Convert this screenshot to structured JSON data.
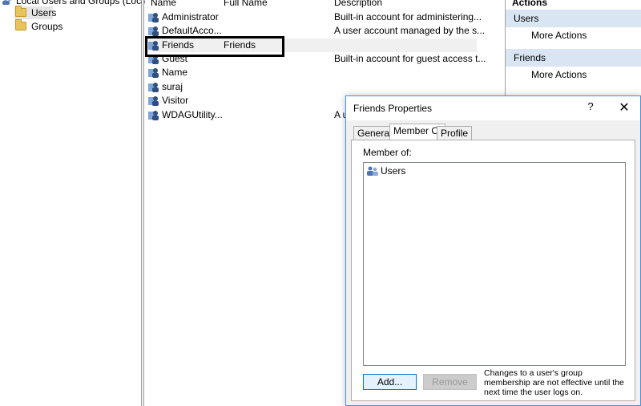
{
  "tree": {
    "root_label": "Local Users and Groups (Local)",
    "items": [
      {
        "label": "Users",
        "selected": true
      },
      {
        "label": "Groups",
        "selected": false
      }
    ]
  },
  "list": {
    "columns": [
      "Name",
      "Full Name",
      "Description"
    ],
    "rows": [
      {
        "name": "Administrator",
        "full_name": "",
        "description": "Built-in account for administering..."
      },
      {
        "name": "DefaultAcco...",
        "full_name": "",
        "description": "A user account managed by the s..."
      },
      {
        "name": "Friends",
        "full_name": "Friends",
        "description": ""
      },
      {
        "name": "Guest",
        "full_name": "",
        "description": "Built-in account for guest access t..."
      },
      {
        "name": "Name",
        "full_name": "",
        "description": ""
      },
      {
        "name": "suraj",
        "full_name": "",
        "description": ""
      },
      {
        "name": "Visitor",
        "full_name": "",
        "description": ""
      },
      {
        "name": "WDAGUtility...",
        "full_name": "",
        "description": "A u"
      }
    ]
  },
  "actions": {
    "title": "Actions",
    "sections": [
      {
        "header": "Users",
        "item": "More Actions"
      },
      {
        "header": "Friends",
        "item": "More Actions"
      }
    ]
  },
  "dialog": {
    "title": "Friends Properties",
    "help": "?",
    "close": "✕",
    "tabs": [
      "General",
      "Member Of",
      "Profile"
    ],
    "active_tab": "Member Of",
    "member_of_label": "Member of:",
    "members": [
      "Users"
    ],
    "add_label": "Add...",
    "remove_label": "Remove",
    "note": "Changes to a user's group membership are not effective until the next time the user logs on."
  }
}
